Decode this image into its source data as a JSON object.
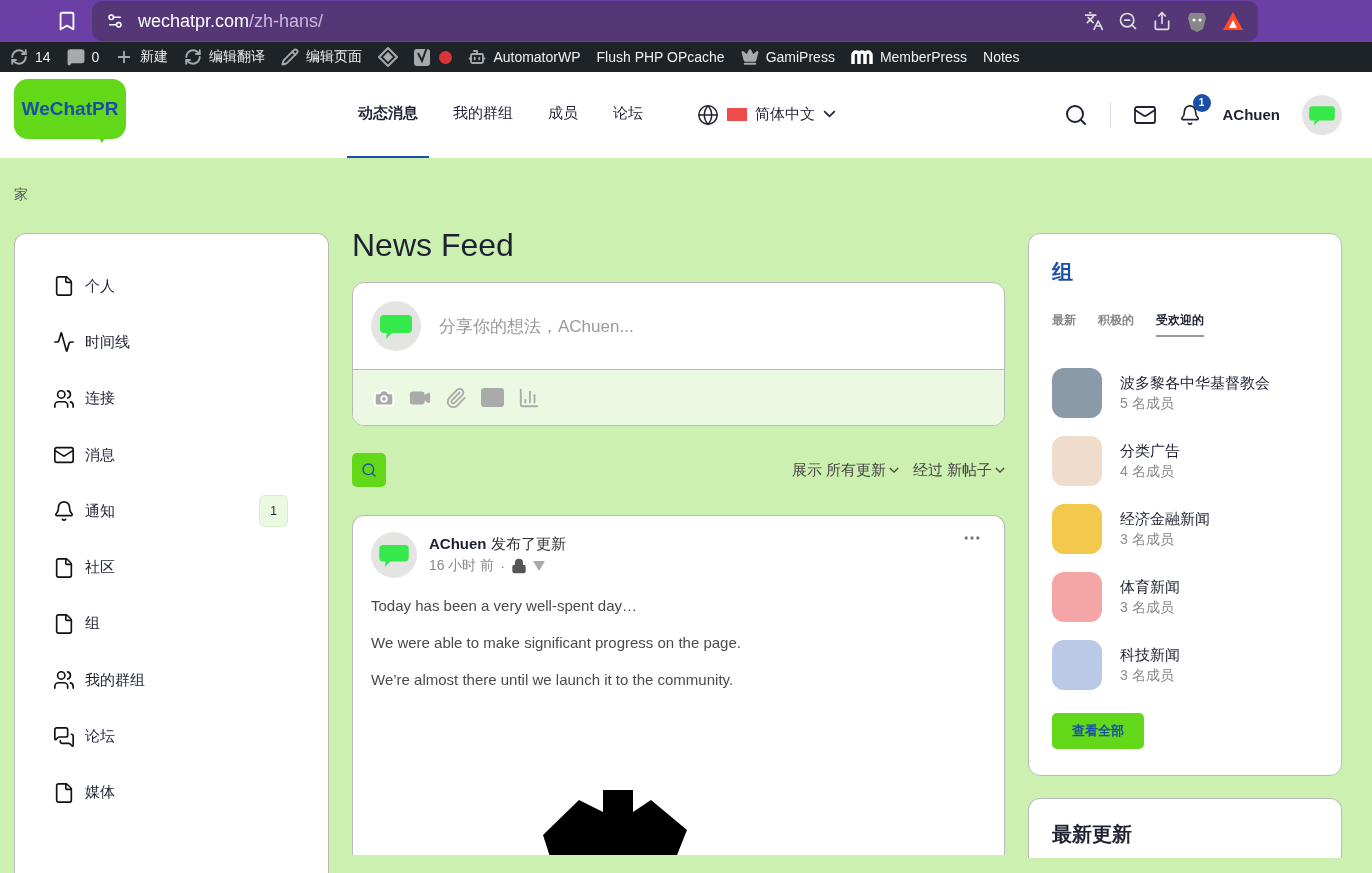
{
  "browser": {
    "url_host": "wechatpr.com",
    "url_path": "/zh-hans/"
  },
  "admin_bar": {
    "items": [
      {
        "kind": "updates",
        "label": "14"
      },
      {
        "kind": "comments",
        "label": "0"
      },
      {
        "kind": "new",
        "label": "新建"
      },
      {
        "kind": "translate",
        "label": "编辑翻译"
      },
      {
        "kind": "edit",
        "label": "编辑页面"
      },
      {
        "kind": "diamond"
      },
      {
        "kind": "yoast"
      },
      {
        "kind": "robot",
        "label": "AutomatorWP"
      },
      {
        "kind": "plain",
        "label": "Flush PHP OPcache"
      },
      {
        "kind": "crown",
        "label": "GamiPress"
      },
      {
        "kind": "brand",
        "label": "MemberPress"
      },
      {
        "kind": "plain",
        "label": "Notes"
      }
    ]
  },
  "header": {
    "logo": "WeChatPR",
    "nav": [
      {
        "label": "动态消息",
        "selected": true
      },
      {
        "label": "我的群组",
        "selected": false
      },
      {
        "label": "成员",
        "selected": false
      },
      {
        "label": "论坛",
        "selected": false
      }
    ],
    "language": "简体中文",
    "notification_count": "1",
    "user_name": "AChuen"
  },
  "breadcrumb": "家",
  "sidebar": {
    "items": [
      {
        "kind": "page",
        "label": "个人"
      },
      {
        "kind": "activity",
        "label": "时间线"
      },
      {
        "kind": "people",
        "label": "连接"
      },
      {
        "kind": "mail",
        "label": "消息"
      },
      {
        "kind": "bell",
        "label": "通知",
        "badge": "1"
      },
      {
        "kind": "page",
        "label": "社区"
      },
      {
        "kind": "page",
        "label": "组"
      },
      {
        "kind": "group",
        "label": "我的群组"
      },
      {
        "kind": "forum",
        "label": "论坛"
      },
      {
        "kind": "page",
        "label": "媒体"
      }
    ]
  },
  "feed": {
    "title": "News Feed",
    "composer_placeholder": "分享你的想法，AChuen...",
    "filters": [
      {
        "label": "展示",
        "value": "所有更新"
      },
      {
        "label": "经过",
        "value": "新帖子"
      }
    ],
    "post": {
      "author": "AChuen",
      "action": "发布了更新",
      "time": "16 小时 前",
      "separator": "·",
      "paragraphs": [
        "Today has been a very well-spent day…",
        "We were able to make significant progress on the page.",
        "We’re almost there until we launch it to the community."
      ]
    }
  },
  "groups_widget": {
    "title": "组",
    "tabs": [
      {
        "label": "最新",
        "selected": false
      },
      {
        "label": "积极的",
        "selected": false
      },
      {
        "label": "受欢迎的",
        "selected": true
      }
    ],
    "groups": [
      {
        "name": "波多黎各中华基督教会",
        "members": "5 名成员"
      },
      {
        "name": "分类广告",
        "members": "4 名成员"
      },
      {
        "name": "经济金融新闻",
        "members": "3 名成员"
      },
      {
        "name": "体育新闻",
        "members": "3 名成员"
      },
      {
        "name": "科技新闻",
        "members": "3 名成员"
      }
    ],
    "view_all": "查看全部"
  },
  "updates_widget": {
    "title": "最新更新"
  }
}
